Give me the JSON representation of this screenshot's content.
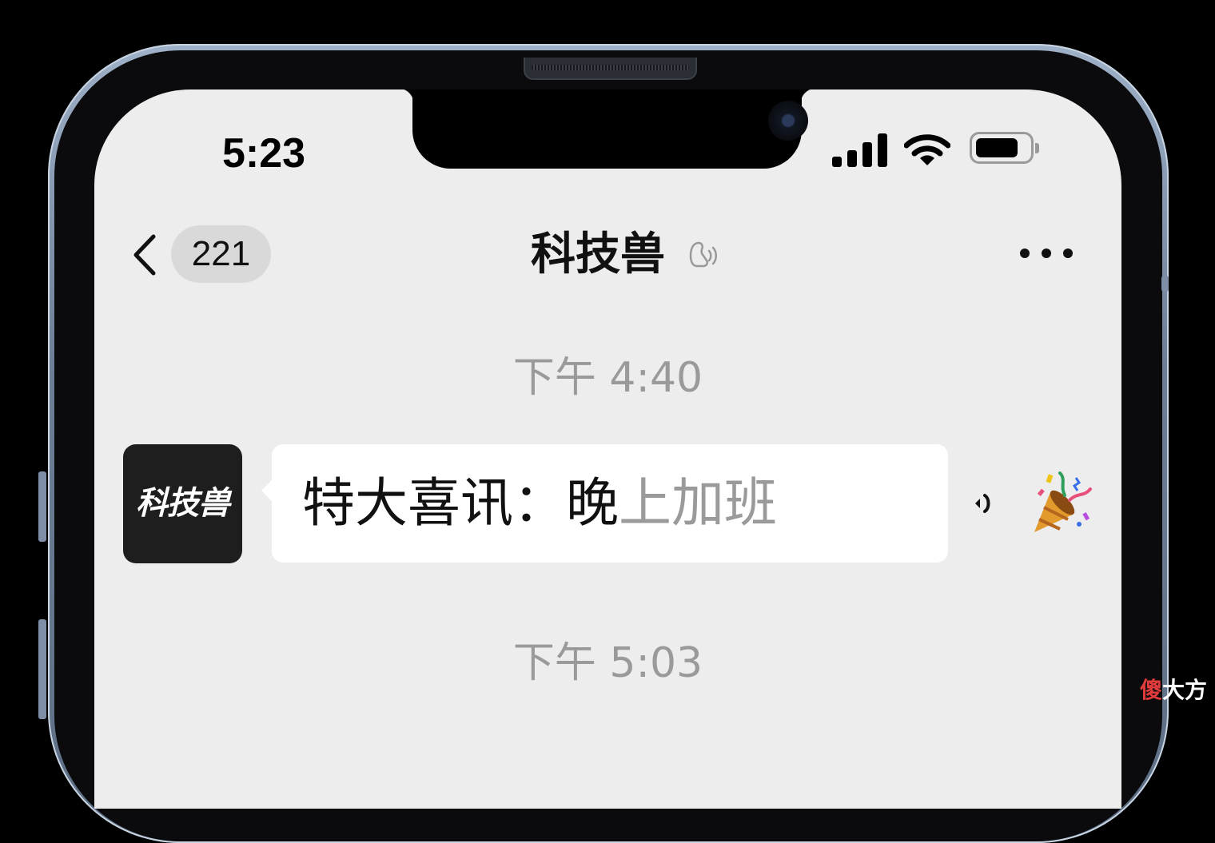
{
  "status_bar": {
    "time": "5:23"
  },
  "nav": {
    "back_count": "221",
    "title": "科技兽"
  },
  "messages": [
    {
      "timestamp": "下午 4:40"
    },
    {
      "avatar_text": "科技兽",
      "text_main": "特大喜讯：晚",
      "text_dim": "上加班",
      "emoji": "party-popper-icon"
    },
    {
      "timestamp": "下午 5:03"
    }
  ],
  "watermark": {
    "first": "傻",
    "rest": "大方"
  },
  "colors": {
    "screen_bg": "#ededed",
    "bubble_bg": "#ffffff",
    "timestamp_text": "#9a9a9a",
    "badge_bg": "#d9d9d9"
  }
}
